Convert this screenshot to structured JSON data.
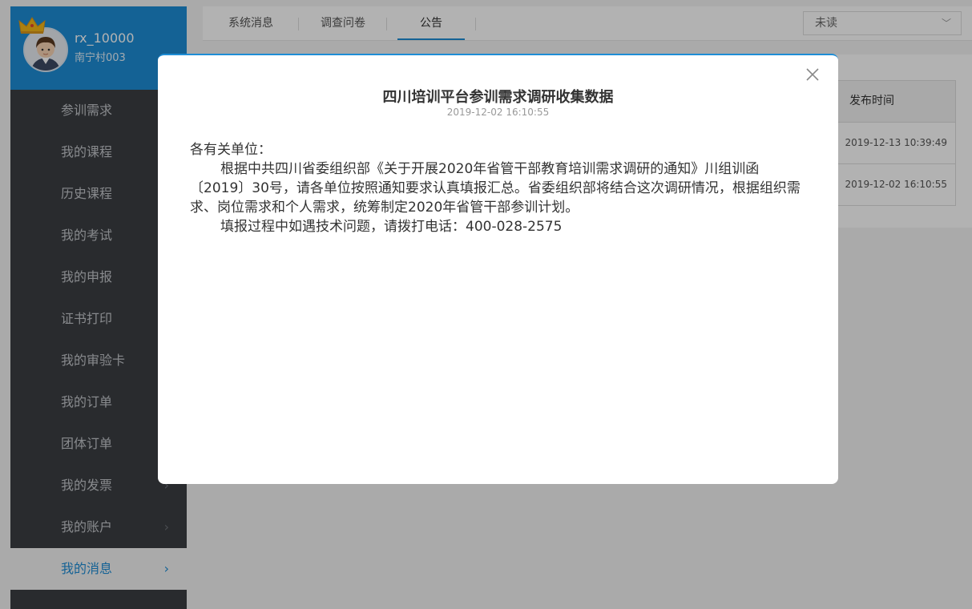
{
  "profile": {
    "username": "rx_10000",
    "org": "南宁村003"
  },
  "menu": [
    {
      "label": "参训需求",
      "has_chevron": false,
      "active": false
    },
    {
      "label": "我的课程",
      "has_chevron": false,
      "active": false
    },
    {
      "label": "历史课程",
      "has_chevron": false,
      "active": false
    },
    {
      "label": "我的考试",
      "has_chevron": false,
      "active": false
    },
    {
      "label": "我的申报",
      "has_chevron": false,
      "active": false
    },
    {
      "label": "证书打印",
      "has_chevron": false,
      "active": false
    },
    {
      "label": "我的审验卡",
      "has_chevron": false,
      "active": false
    },
    {
      "label": "我的订单",
      "has_chevron": false,
      "active": false
    },
    {
      "label": "团体订单",
      "has_chevron": false,
      "active": false
    },
    {
      "label": "我的发票",
      "has_chevron": true,
      "active": false
    },
    {
      "label": "我的账户",
      "has_chevron": true,
      "active": false
    },
    {
      "label": "我的消息",
      "has_chevron": true,
      "active": true
    }
  ],
  "tabs": [
    {
      "label": "系统消息",
      "active": false
    },
    {
      "label": "调查问卷",
      "active": false
    },
    {
      "label": "公告",
      "active": true
    }
  ],
  "filter": {
    "selected": "未读"
  },
  "table": {
    "header": "发布时间",
    "rows": [
      "2019-12-13 10:39:49",
      "2019-12-02 16:10:55"
    ]
  },
  "modal": {
    "title": "四川培训平台参训需求调研收集数据",
    "date": "2019-12-02 16:10:55",
    "greeting": "各有关单位：",
    "para1": "根据中共四川省委组织部《关于开展2020年省管干部教育培训需求调研的通知》川组训函〔2019〕30号，请各单位按照通知要求认真填报汇总。省委组织部将结合这次调研情况，根据组织需求、岗位需求和个人需求，统筹制定2020年省管干部参训计划。",
    "para2": "填报过程中如遇技术问题，请拨打电话：400-028-2575"
  },
  "colors": {
    "accent": "#1e8dd6",
    "sidebar": "#3b3e43"
  }
}
